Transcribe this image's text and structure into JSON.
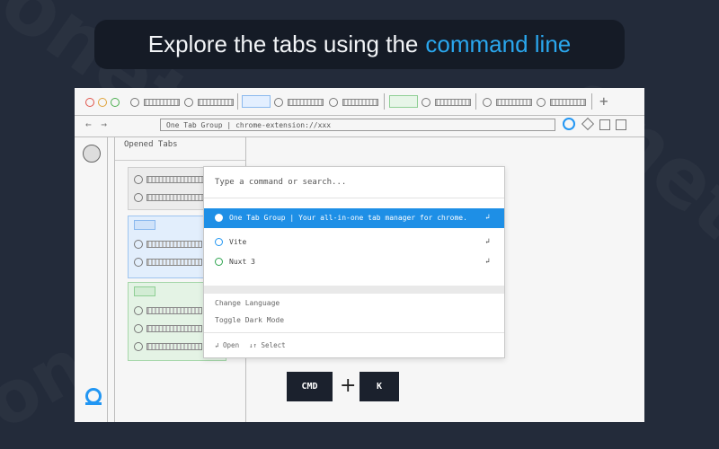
{
  "headline": {
    "prefix": "Explore the tabs using the",
    "accent": "command line"
  },
  "watermark": "onetab",
  "browser": {
    "url": "One Tab Group | chrome-extension://xxx",
    "nav_arrows": "← →",
    "new_tab_symbol": "+"
  },
  "panel": {
    "title": "Opened Tabs"
  },
  "palette": {
    "placeholder": "Type a command or search...",
    "results": [
      {
        "label": "One Tab Group | Your all-in-one tab manager for chrome.",
        "active": true,
        "icon_color": "#ffffff"
      },
      {
        "label": "Vite",
        "active": false,
        "icon_color": "#2196f3"
      },
      {
        "label": "Nuxt 3",
        "active": false,
        "icon_color": "#2ea44f"
      }
    ],
    "enter_symbol": "↲",
    "commands": [
      "Change Language",
      "Toggle Dark Mode"
    ],
    "footer": {
      "open_label": "↲ Open",
      "select_label": "↓↑ Select"
    }
  },
  "shortcut": {
    "key1": "CMD",
    "plus": "+",
    "key2": "K"
  },
  "colors": {
    "accent": "#2aa7ee",
    "background": "#232b3a",
    "pill": "#151b26",
    "active_row": "#1e8fe6"
  }
}
